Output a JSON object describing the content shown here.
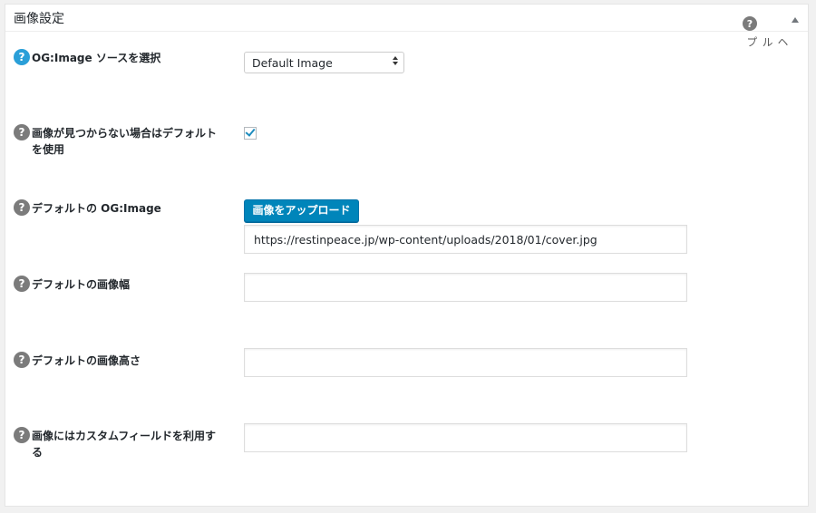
{
  "panel": {
    "title": "画像設定",
    "toggle_icon": "triangle-up-icon"
  },
  "help": {
    "icon": "question-icon",
    "label": "ヘルプ"
  },
  "fields": {
    "source": {
      "label": "OG:Image ソースを選択",
      "selected": "Default Image"
    },
    "fallback": {
      "label": "画像が見つからない場合はデフォルトを使用",
      "checked": true
    },
    "default_image": {
      "label": "デフォルトの OG:Image",
      "upload_label": "画像をアップロード",
      "url_value": "https://restinpeace.jp/wp-content/uploads/2018/01/cover.jpg"
    },
    "width": {
      "label": "デフォルトの画像幅",
      "value": ""
    },
    "height": {
      "label": "デフォルトの画像高さ",
      "value": ""
    },
    "custom_field": {
      "label": "画像にはカスタムフィールドを利用する",
      "value": ""
    }
  },
  "colors": {
    "accent": "#0085ba",
    "help_active": "#2a9fd8",
    "help_inactive": "#7b7b7b"
  }
}
